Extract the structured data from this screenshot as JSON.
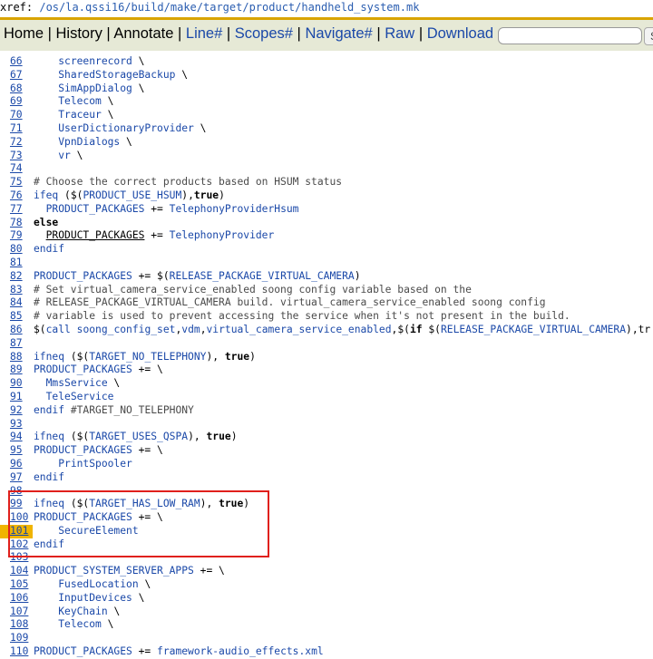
{
  "xref": {
    "prefix": "xref: ",
    "path": [
      "/os",
      "/la.qssi16",
      "/build",
      "/make",
      "/target",
      "/product",
      "/handheld_system.mk"
    ]
  },
  "menu": [
    {
      "label": "Home",
      "style": "dark"
    },
    {
      "label": "History",
      "style": "dark"
    },
    {
      "label": "Annotate",
      "style": "dark"
    },
    {
      "label": "Line#",
      "style": "blue"
    },
    {
      "label": "Scopes#",
      "style": "blue"
    },
    {
      "label": "Navigate#",
      "style": "blue"
    },
    {
      "label": "Raw",
      "style": "blue"
    },
    {
      "label": "Download",
      "style": "blue"
    }
  ],
  "search": {
    "placeholder": "",
    "button_label": "S"
  },
  "highlighted_line": "101",
  "lines": [
    {
      "n": "66",
      "html": "    <span class='v'>screenrecord</span> \\"
    },
    {
      "n": "67",
      "html": "    <span class='v'>SharedStorageBackup</span> \\"
    },
    {
      "n": "68",
      "html": "    <span class='v'>SimAppDialog</span> \\"
    },
    {
      "n": "69",
      "html": "    <span class='v'>Telecom</span> \\"
    },
    {
      "n": "70",
      "html": "    <span class='v'>Traceur</span> \\"
    },
    {
      "n": "71",
      "html": "    <span class='v'>UserDictionaryProvider</span> \\"
    },
    {
      "n": "72",
      "html": "    <span class='v'>VpnDialogs</span> \\"
    },
    {
      "n": "73",
      "html": "    <span class='v'>vr</span> \\"
    },
    {
      "n": "74",
      "html": ""
    },
    {
      "n": "75",
      "html": "<span class='c'># Choose the correct products based on HSUM status</span>"
    },
    {
      "n": "76",
      "html": "<span class='v'>ifeq</span> ($(<span class='v'>PRODUCT_USE_HSUM</span>),<span class='k'>true</span>)"
    },
    {
      "n": "77",
      "html": "  <span class='v'>PRODUCT_PACKAGES</span> += <span class='v'>TelephonyProviderHsum</span>"
    },
    {
      "n": "78",
      "html": "<span class='k'>else</span>"
    },
    {
      "n": "79",
      "html": "  <span class='u'>PRODUCT_PACKAGES</span> += <span class='v'>TelephonyProvider</span>"
    },
    {
      "n": "80",
      "html": "<span class='v'>endif</span>"
    },
    {
      "n": "81",
      "html": ""
    },
    {
      "n": "82",
      "html": "<span class='v'>PRODUCT_PACKAGES</span> += $(<span class='v'>RELEASE_PACKAGE_VIRTUAL_CAMERA</span>)"
    },
    {
      "n": "83",
      "html": "<span class='c'># Set virtual_camera_service_enabled soong config variable based on the</span>"
    },
    {
      "n": "84",
      "html": "<span class='c'># RELEASE_PACKAGE_VIRTUAL_CAMERA build. virtual_camera_service_enabled soong config</span>"
    },
    {
      "n": "85",
      "html": "<span class='c'># variable is used to prevent accessing the service when it's not present in the build.</span>"
    },
    {
      "n": "86",
      "html": "$(<span class='v'>call</span> <span class='v'>soong_config_set</span>,<span class='v'>vdm</span>,<span class='v'>virtual_camera_service_enabled</span>,$(<span class='k'>if</span> $(<span class='v'>RELEASE_PACKAGE_VIRTUAL_CAMERA</span>),tr"
    },
    {
      "n": "87",
      "html": ""
    },
    {
      "n": "88",
      "html": "<span class='v'>ifneq</span> ($(<span class='v'>TARGET_NO_TELEPHONY</span>), <span class='k'>true</span>)"
    },
    {
      "n": "89",
      "html": "<span class='v'>PRODUCT_PACKAGES</span> += \\"
    },
    {
      "n": "90",
      "html": "  <span class='v'>MmsService</span> \\"
    },
    {
      "n": "91",
      "html": "  <span class='v'>TeleService</span>"
    },
    {
      "n": "92",
      "html": "<span class='v'>endif</span> <span class='c'>#TARGET_NO_TELEPHONY</span>"
    },
    {
      "n": "93",
      "html": ""
    },
    {
      "n": "94",
      "html": "<span class='v'>ifneq</span> ($(<span class='v'>TARGET_USES_QSPA</span>), <span class='k'>true</span>)"
    },
    {
      "n": "95",
      "html": "<span class='v'>PRODUCT_PACKAGES</span> += \\"
    },
    {
      "n": "96",
      "html": "    <span class='v'>PrintSpooler</span>"
    },
    {
      "n": "97",
      "html": "<span class='v'>endif</span>"
    },
    {
      "n": "98",
      "html": ""
    },
    {
      "n": "99",
      "html": "<span class='v'>ifneq</span> ($(<span class='v'>TARGET_HAS_LOW_RAM</span>), <span class='k'>true</span>)"
    },
    {
      "n": "100",
      "html": "<span class='v'>PRODUCT_PACKAGES</span> += \\"
    },
    {
      "n": "101",
      "html": "    <span class='v'>SecureElement</span>"
    },
    {
      "n": "102",
      "html": "<span class='v'>endif</span>"
    },
    {
      "n": "103",
      "html": ""
    },
    {
      "n": "104",
      "html": "<span class='v'>PRODUCT_SYSTEM_SERVER_APPS</span> += \\"
    },
    {
      "n": "105",
      "html": "    <span class='v'>FusedLocation</span> \\"
    },
    {
      "n": "106",
      "html": "    <span class='v'>InputDevices</span> \\"
    },
    {
      "n": "107",
      "html": "    <span class='v'>KeyChain</span> \\"
    },
    {
      "n": "108",
      "html": "    <span class='v'>Telecom</span> \\"
    },
    {
      "n": "109",
      "html": ""
    },
    {
      "n": "110",
      "html": "<span class='v'>PRODUCT_PACKAGES</span> += <span class='v'>framework-audio_effects.xml</span>"
    }
  ]
}
